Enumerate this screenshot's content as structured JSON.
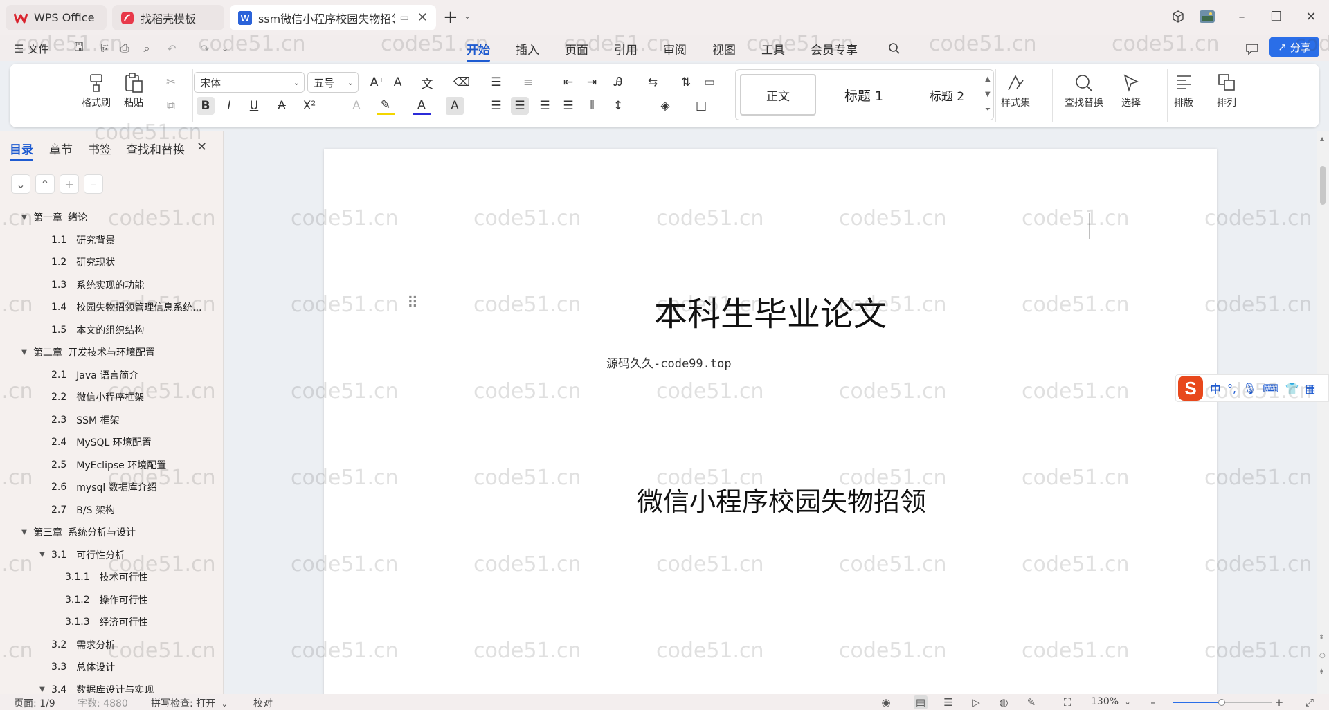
{
  "tabs": [
    {
      "label": "WPS Office",
      "icon": "wps-logo-icon"
    },
    {
      "label": "找稻壳模板",
      "icon": "docer-icon"
    },
    {
      "label": "ssm微信小程序校园失物招领",
      "icon": "writer-doc-icon"
    }
  ],
  "new_tab_label": "+",
  "menu": {
    "file_label": "文件",
    "items": [
      "开始",
      "插入",
      "页面",
      "引用",
      "审阅",
      "视图",
      "工具",
      "会员专享"
    ],
    "share_label": "分享"
  },
  "ribbon": {
    "format_painter": "格式刷",
    "paste": "粘贴",
    "font_name": "宋体",
    "font_size": "五号",
    "styles": [
      "正文",
      "标题 1",
      "标题 2"
    ],
    "style_set": "样式集",
    "find_replace": "查找替换",
    "select": "选择",
    "layout": "排版",
    "arrange": "排列"
  },
  "sidebar": {
    "tabs": [
      "目录",
      "章节",
      "书签",
      "查找和替换"
    ],
    "toc": [
      {
        "level": 1,
        "num": "第一章",
        "text": "绪论",
        "expanded": true
      },
      {
        "level": 2,
        "num": "1.1",
        "text": "研究背景"
      },
      {
        "level": 2,
        "num": "1.2",
        "text": "研究现状"
      },
      {
        "level": 2,
        "num": "1.3",
        "text": "系统实现的功能"
      },
      {
        "level": 2,
        "num": "1.4",
        "text": "校园失物招领管理信息系统..."
      },
      {
        "level": 2,
        "num": "1.5",
        "text": "本文的组织结构"
      },
      {
        "level": 1,
        "num": "第二章",
        "text": "开发技术与环境配置",
        "expanded": true
      },
      {
        "level": 2,
        "num": "2.1",
        "text": "Java 语言简介"
      },
      {
        "level": 2,
        "num": "2.2",
        "text": "微信小程序框架"
      },
      {
        "level": 2,
        "num": "2.3",
        "text": "SSM 框架"
      },
      {
        "level": 2,
        "num": "2.4",
        "text": "MySQL 环境配置"
      },
      {
        "level": 2,
        "num": "2.5",
        "text": "MyEclipse 环境配置"
      },
      {
        "level": 2,
        "num": "2.6",
        "text": "mysql 数据库介绍"
      },
      {
        "level": 2,
        "num": "2.7",
        "text": "B/S 架构"
      },
      {
        "level": 1,
        "num": "第三章",
        "text": "系统分析与设计",
        "expanded": true
      },
      {
        "level": 2,
        "num": "3.1",
        "text": "可行性分析",
        "expanded": true
      },
      {
        "level": 3,
        "num": "3.1.1",
        "text": "技术可行性"
      },
      {
        "level": 3,
        "num": "3.1.2",
        "text": "操作可行性"
      },
      {
        "level": 3,
        "num": "3.1.3",
        "text": "经济可行性"
      },
      {
        "level": 2,
        "num": "3.2",
        "text": "需求分析"
      },
      {
        "level": 2,
        "num": "3.3",
        "text": "总体设计"
      },
      {
        "level": 2,
        "num": "3.4",
        "text": "数据库设计与实现",
        "expanded": true
      }
    ]
  },
  "document": {
    "title": "本科生毕业论文",
    "source_line": "源码久久-code99.top",
    "subtitle": "微信小程序校园失物招领"
  },
  "watermark": "code51.cn",
  "ime": {
    "mode": "中",
    "punct": "°,"
  },
  "status": {
    "page": "页面: 1/9",
    "words": "字数: 4880",
    "spell": "拼写检查: 打开",
    "proof": "校对",
    "zoom": "130%"
  }
}
